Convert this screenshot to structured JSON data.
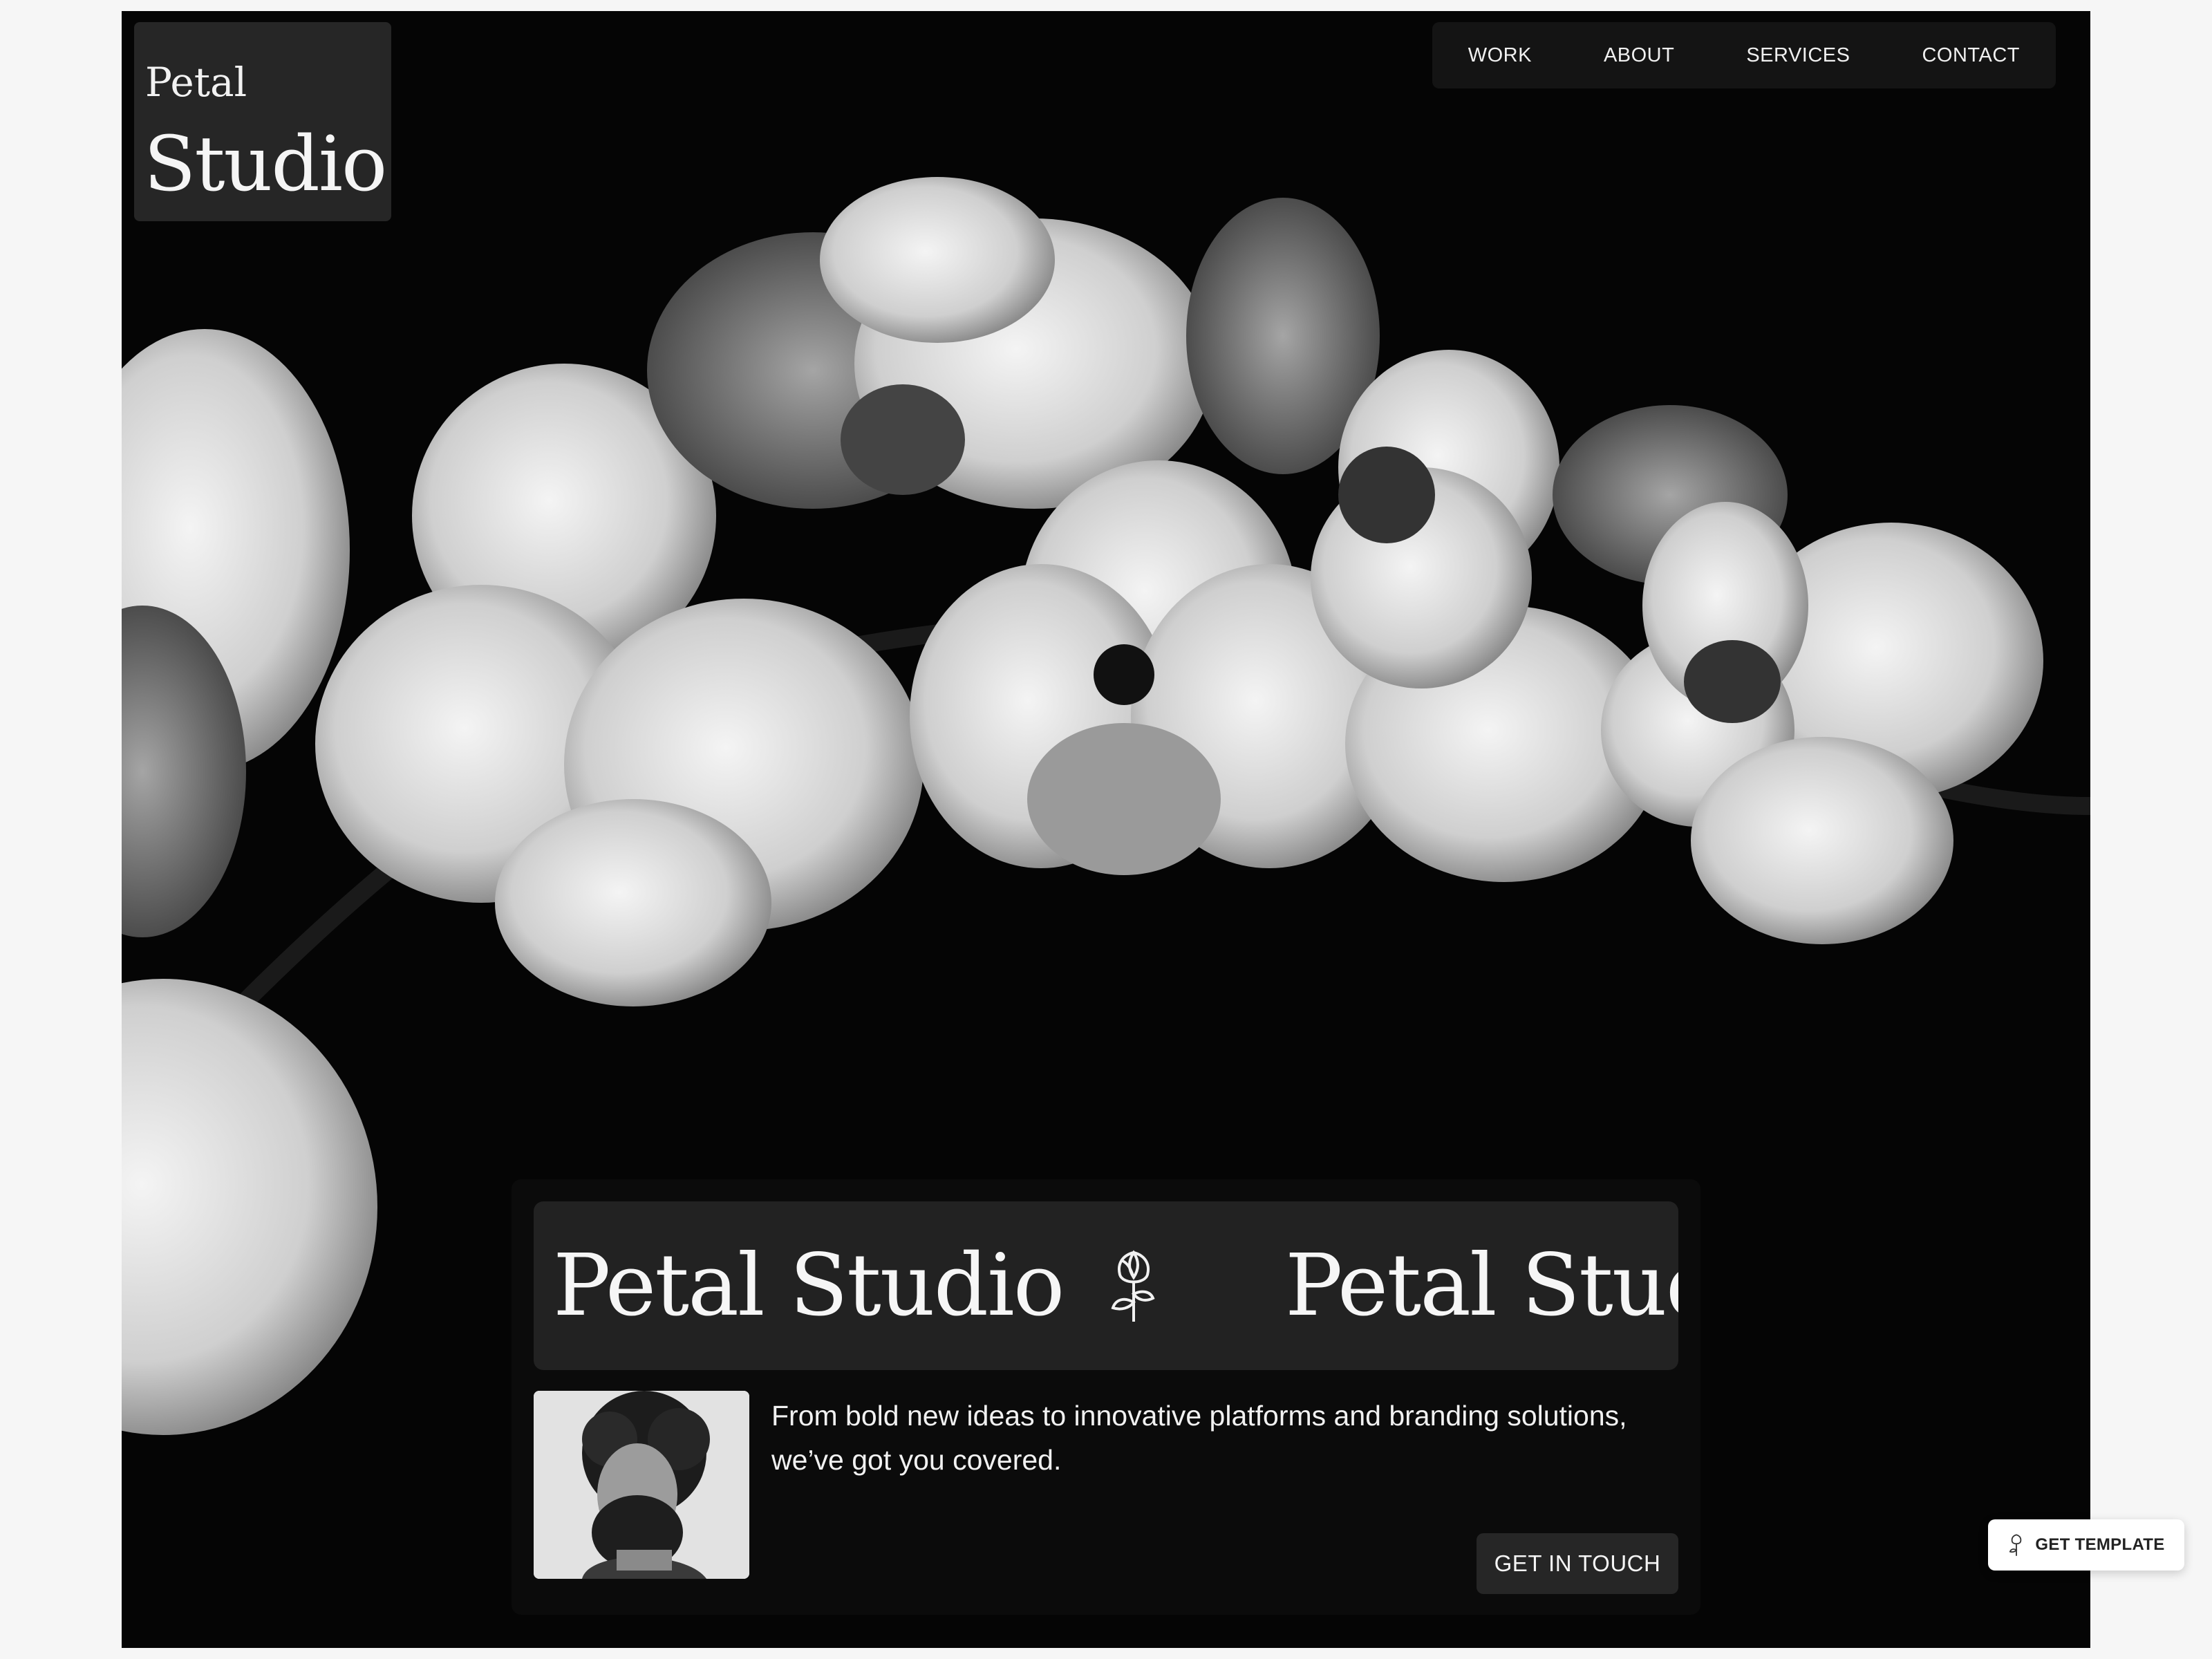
{
  "brand": {
    "small": "Petal",
    "big": "Studio"
  },
  "nav": {
    "items": [
      {
        "label": "WORK"
      },
      {
        "label": "ABOUT"
      },
      {
        "label": "SERVICES"
      },
      {
        "label": "CONTACT"
      }
    ]
  },
  "hero": {
    "marquee": {
      "text_1": "Petal Studio",
      "text_2": "Petal Studio",
      "icon": "rose-icon"
    },
    "tagline": "From bold new ideas to innovative platforms and branding solutions, we’ve got you covered.",
    "cta_label": "GET IN TOUCH"
  },
  "floating": {
    "get_template_label": "GET TEMPLATE",
    "icon": "rose-icon"
  },
  "colors": {
    "background": "#060606",
    "page": "#f6f6f6",
    "panel": "#0b0b0b",
    "card": "#222222",
    "text": "#f5f5f5"
  }
}
